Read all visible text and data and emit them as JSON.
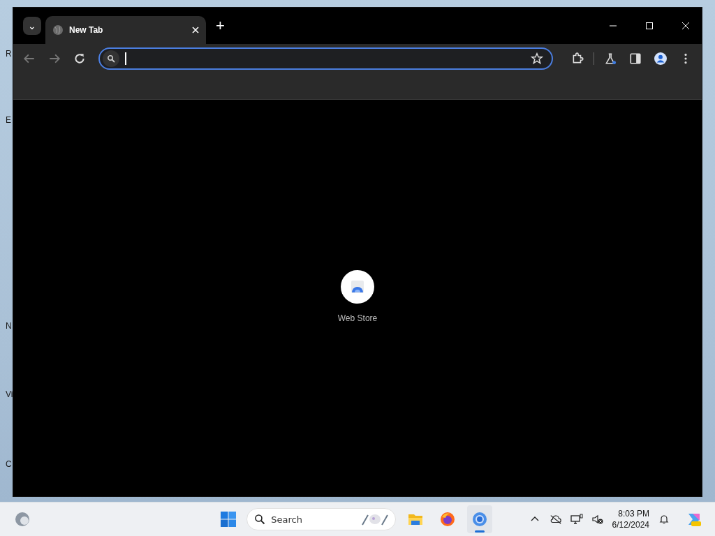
{
  "desktop": {
    "icon_labels": [
      "R",
      "E",
      "N",
      "Vi",
      "C"
    ]
  },
  "browser": {
    "tab_search_button": "⌄",
    "tabs": [
      {
        "title": "New Tab",
        "selected": true
      }
    ],
    "new_tab": "+",
    "shortcuts": [
      {
        "label": "Web Store"
      }
    ]
  },
  "taskbar": {
    "search": {
      "placeholder": "Search"
    },
    "apps": [
      {
        "kind": "files",
        "selected": false
      },
      {
        "kind": "firefox",
        "selected": false
      },
      {
        "kind": "chrome",
        "selected": true
      }
    ],
    "time": "8:03 PM",
    "date": "6/12/2024"
  }
}
